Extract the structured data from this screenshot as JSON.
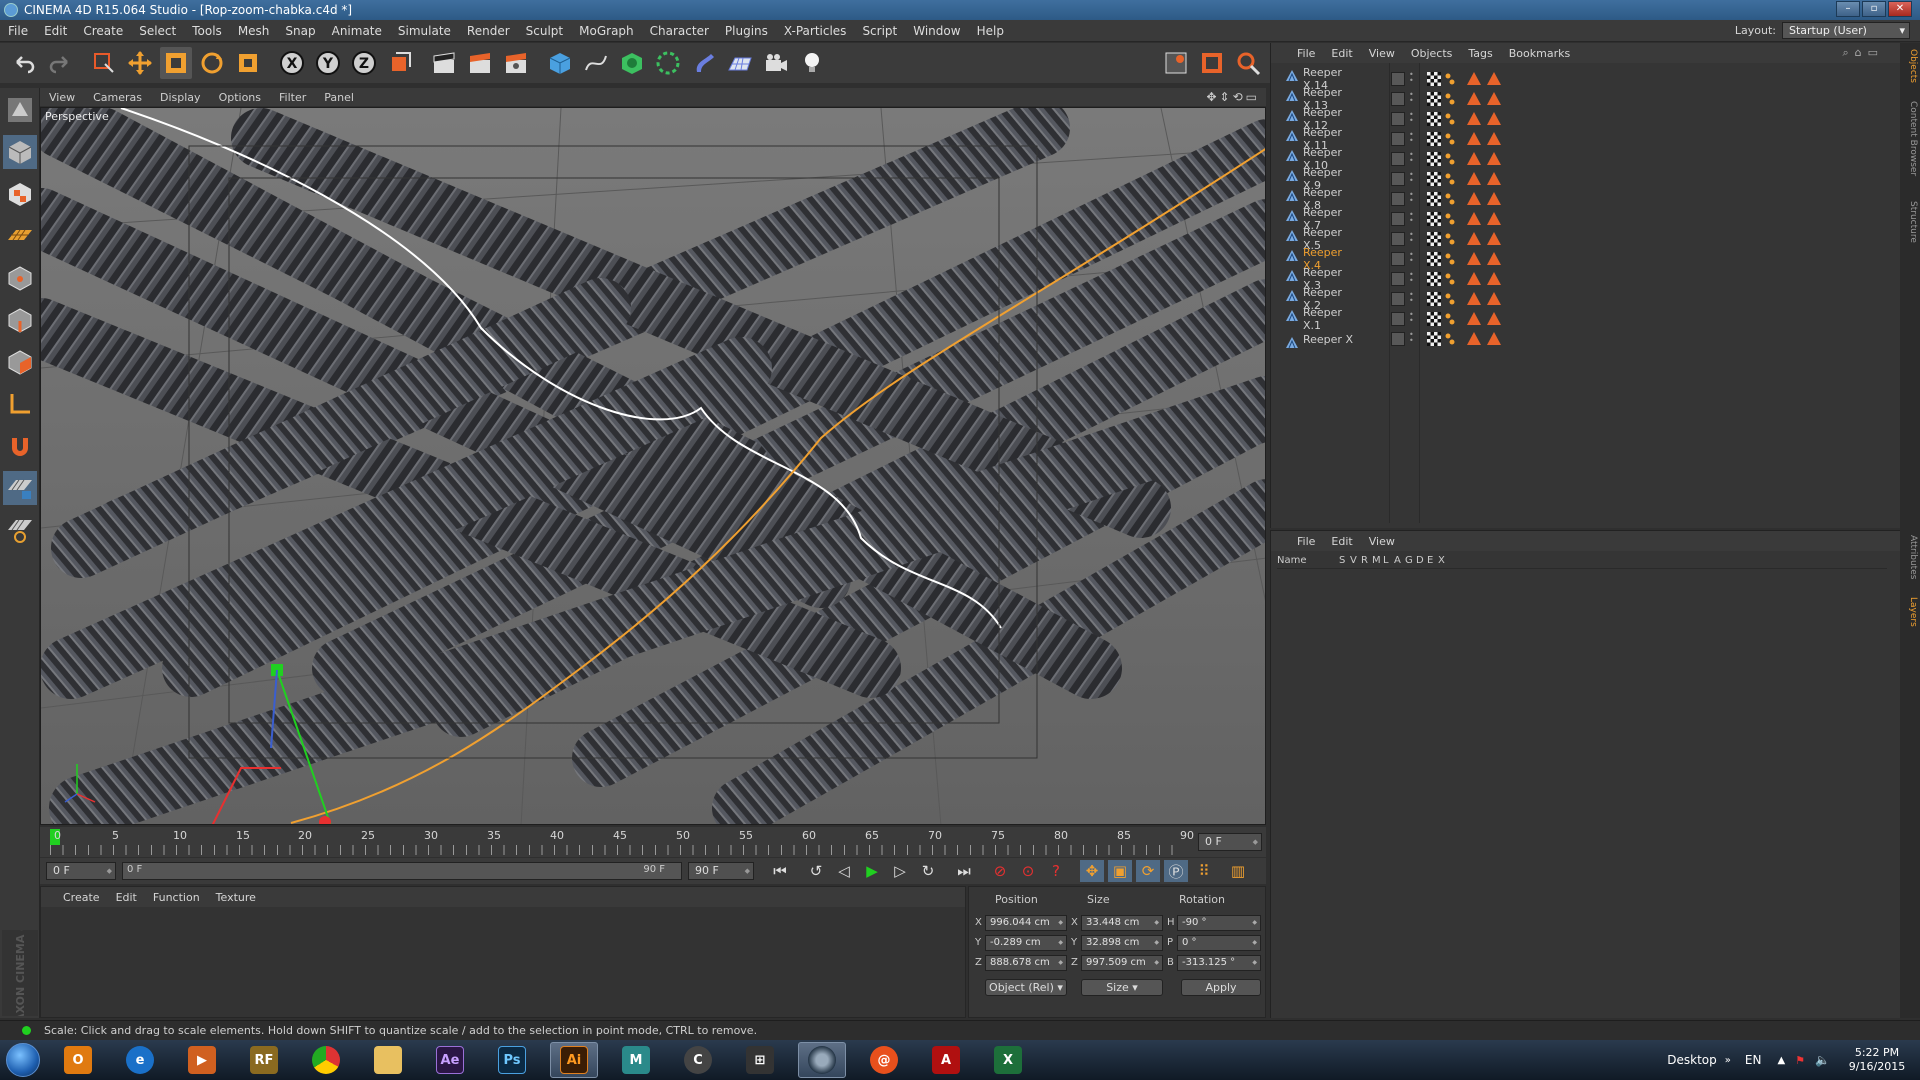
{
  "window": {
    "title": "CINEMA 4D R15.064 Studio - [Rop-zoom-chabka.c4d *]"
  },
  "menu": [
    "File",
    "Edit",
    "Create",
    "Select",
    "Tools",
    "Mesh",
    "Snap",
    "Animate",
    "Simulate",
    "Render",
    "Sculpt",
    "MoGraph",
    "Character",
    "Plugins",
    "X-Particles",
    "Script",
    "Window",
    "Help"
  ],
  "layout": {
    "label": "Layout:",
    "value": "Startup (User)"
  },
  "viewport": {
    "menu": [
      "View",
      "Cameras",
      "Display",
      "Options",
      "Filter",
      "Panel"
    ],
    "label": "Perspective"
  },
  "timeline": {
    "ticks": [
      "0",
      "5",
      "10",
      "15",
      "20",
      "25",
      "30",
      "35",
      "40",
      "45",
      "50",
      "55",
      "60",
      "65",
      "70",
      "75",
      "80",
      "85",
      "90"
    ],
    "current": "0 F"
  },
  "transport": {
    "start": "0 F",
    "range_start": "0 F",
    "range_end": "90 F",
    "end": "90 F"
  },
  "material_manager": {
    "menu": [
      "Create",
      "Edit",
      "Function",
      "Texture"
    ],
    "brand": "MAXON CINEMA 4D"
  },
  "coordinates": {
    "headers": {
      "position": "Position",
      "size": "Size",
      "rotation": "Rotation"
    },
    "axis_labels": [
      "X",
      "Y",
      "Z"
    ],
    "rotation_labels": [
      "H",
      "P",
      "B"
    ],
    "position": [
      "996.044 cm",
      "-0.289 cm",
      "888.678 cm"
    ],
    "size": [
      "33.448 cm",
      "32.898 cm",
      "997.509 cm"
    ],
    "rotation": [
      "-90 °",
      "0 °",
      "-313.125 °"
    ],
    "mode": "Object (Rel)",
    "size_mode": "Size",
    "apply": "Apply"
  },
  "object_manager": {
    "menu": [
      "File",
      "Edit",
      "View",
      "Objects",
      "Tags",
      "Bookmarks"
    ],
    "objects": [
      "Reeper X.14",
      "Reeper X.13",
      "Reeper X.12",
      "Reeper X.11",
      "Reeper X.10",
      "Reeper X.9",
      "Reeper X.8",
      "Reeper X.7",
      "Reeper X.5",
      "Reeper X.4",
      "Reeper X.3",
      "Reeper X.2",
      "Reeper X.1",
      "Reeper X"
    ],
    "selected": "Reeper X.4"
  },
  "layer_manager": {
    "menu": [
      "File",
      "Edit",
      "View"
    ],
    "columns": [
      "Name",
      "S",
      "V",
      "R",
      "M",
      "L",
      "A",
      "G",
      "D",
      "E",
      "X"
    ]
  },
  "side_tabs": [
    "Objects",
    "Content Browser",
    "Structure",
    "Attributes",
    "Layers"
  ],
  "status": "Scale: Click and drag to scale elements. Hold down SHIFT to quantize scale / add to the selection in point mode, CTRL to remove.",
  "taskbar": {
    "apps": [
      "Ae",
      "Ps",
      "Ai"
    ],
    "desktop": "Desktop",
    "lang": "EN",
    "time": "5:22 PM",
    "date": "9/16/2015"
  },
  "colors": {
    "accent_orange": "#f0a030",
    "selected_play": "#20d020",
    "record_red": "#e83030"
  }
}
